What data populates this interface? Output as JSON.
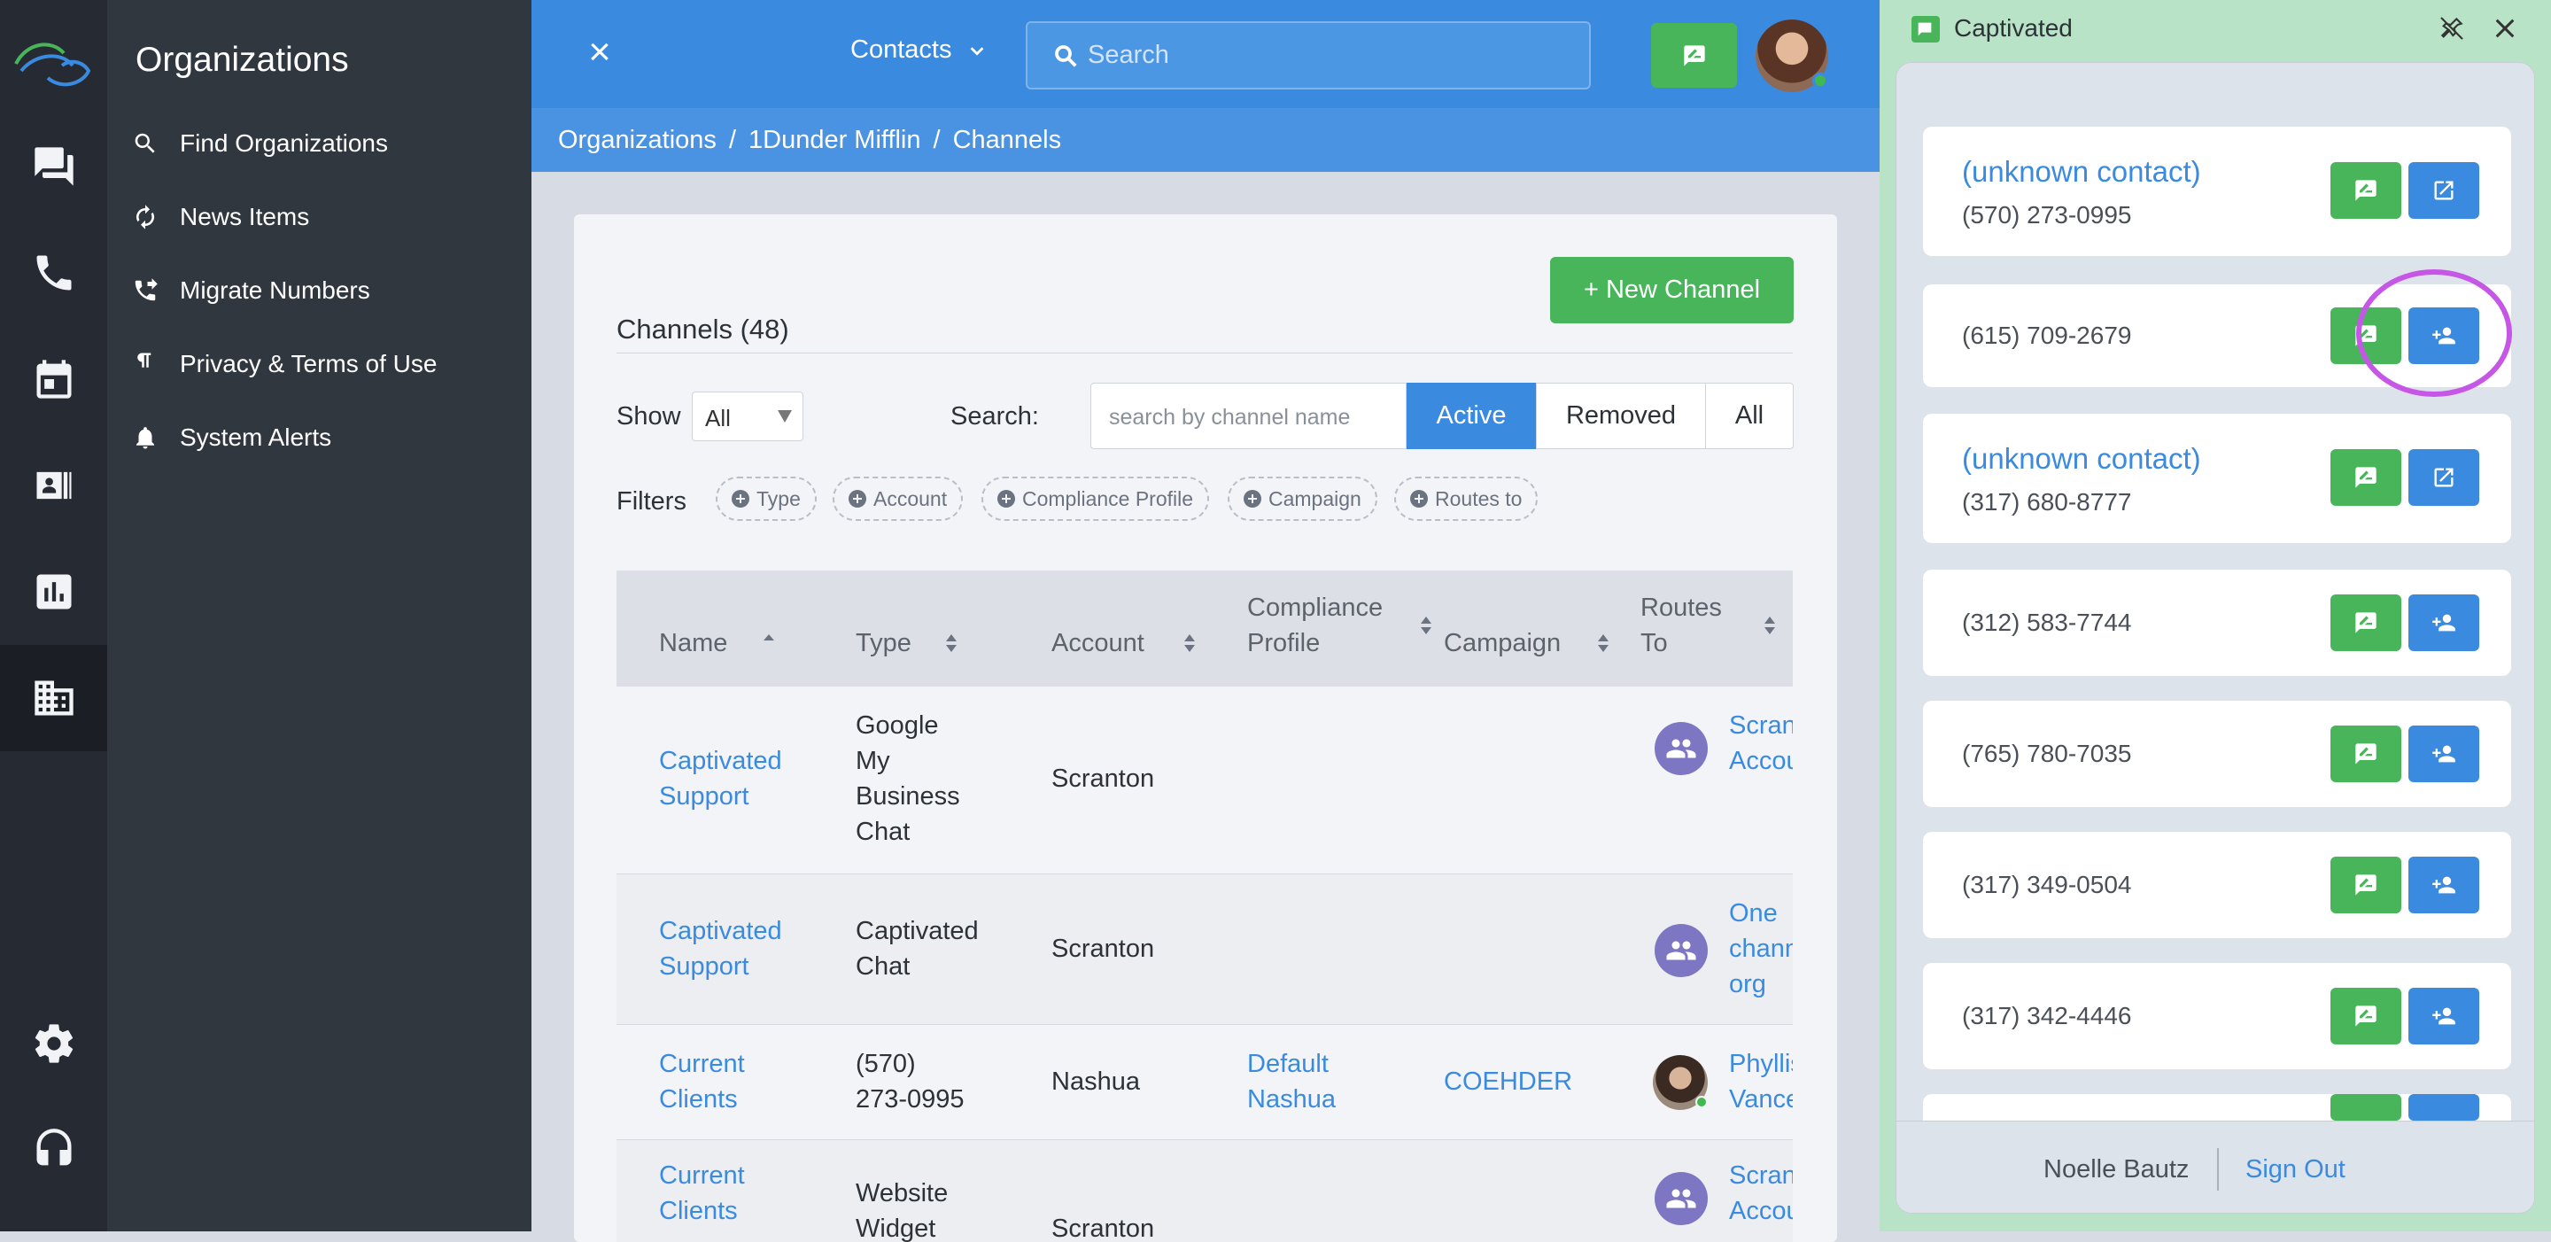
{
  "sidenav": {
    "title": "Organizations",
    "items": [
      {
        "label": "Find Organizations",
        "icon": "search-icon"
      },
      {
        "label": "News Items",
        "icon": "refresh-icon"
      },
      {
        "label": "Migrate Numbers",
        "icon": "phone-forward-icon"
      },
      {
        "label": "Privacy & Terms of Use",
        "icon": "pilcrow-icon"
      },
      {
        "label": "System Alerts",
        "icon": "bell-icon"
      }
    ]
  },
  "rail": {
    "items": [
      "chat-icon",
      "phone-icon",
      "calendar-icon",
      "contacts-icon",
      "reports-icon",
      "organizations-icon",
      "settings-icon",
      "support-icon"
    ]
  },
  "topbar": {
    "close": "×",
    "contacts_label": "Contacts",
    "search_placeholder": "Search"
  },
  "breadcrumb": {
    "items": [
      "Organizations",
      "1Dunder Mifflin",
      "Channels"
    ],
    "separator": "/"
  },
  "channels": {
    "title": "Channels (48)",
    "new_button": "+ New Channel",
    "show_label": "Show",
    "show_value": "All",
    "search_label": "Search:",
    "search_placeholder": "search by channel name",
    "segments": [
      "Active",
      "Removed",
      "All"
    ],
    "active_segment": "Active",
    "filters_label": "Filters",
    "filters": [
      "Type",
      "Account",
      "Compliance Profile",
      "Campaign",
      "Routes to"
    ],
    "columns": [
      "Name",
      "Type",
      "Account",
      "Compliance Profile",
      "Campaign",
      "Routes To"
    ],
    "rows": [
      {
        "name": "Captivated Support",
        "type": "Google My Business Chat",
        "account": "Scranton",
        "compliance": "",
        "campaign": "",
        "routes": "Scranton Account",
        "route_icon": "group-icon"
      },
      {
        "name": "Captivated Support",
        "type": "Captivated Chat",
        "account": "Scranton",
        "compliance": "",
        "campaign": "",
        "routes": "One channel org",
        "route_icon": "group-icon"
      },
      {
        "name": "Current Clients",
        "type": "(570) 273-0995",
        "account": "Nashua",
        "compliance": "Default Nashua",
        "campaign": "COEHDER",
        "routes": "Phyllis Vance",
        "route_icon": "avatar"
      },
      {
        "name": "Current Clients",
        "type": "Website Widget",
        "account": "Scranton",
        "compliance": "",
        "campaign": "",
        "routes": "Scranton Account",
        "route_icon": "group-icon"
      }
    ]
  },
  "panel": {
    "title": "Captivated",
    "contacts": [
      {
        "name": "(unknown contact)",
        "phone": "(570) 273-0995",
        "action": "open-external-icon"
      },
      {
        "name": "",
        "phone": "(615) 709-2679",
        "action": "add-contact-icon"
      },
      {
        "name": "(unknown contact)",
        "phone": "(317) 680-8777",
        "action": "open-external-icon"
      },
      {
        "name": "",
        "phone": "(312) 583-7744",
        "action": "add-contact-icon"
      },
      {
        "name": "",
        "phone": "(765) 780-7035",
        "action": "add-contact-icon"
      },
      {
        "name": "",
        "phone": "(317) 349-0504",
        "action": "add-contact-icon"
      },
      {
        "name": "",
        "phone": "(317) 342-4446",
        "action": "add-contact-icon"
      }
    ],
    "user": "Noelle Bautz",
    "sign_out": "Sign Out"
  },
  "colors": {
    "primary_blue": "#3a8be0",
    "green": "#48b55a",
    "annotation_purple": "#c657e6",
    "sidebar_dark": "#262b33"
  }
}
